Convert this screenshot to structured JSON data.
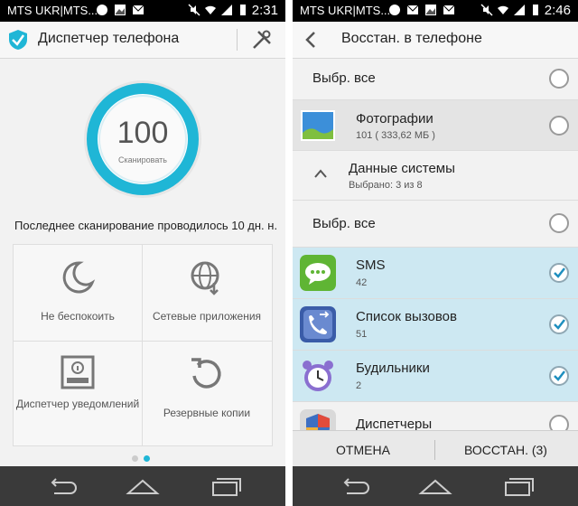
{
  "left_screen": {
    "status": {
      "carrier": "MTS UKR|MTS...",
      "time": "2:31"
    },
    "header": {
      "title": "Диспетчер телефона"
    },
    "gauge": {
      "score": "100",
      "label": "Сканировать"
    },
    "last_scan": "Последнее сканирование проводилось 10 дн. н...",
    "tiles": [
      {
        "label": "Не беспокоить",
        "icon": "moon-icon"
      },
      {
        "label": "Сетевые приложения",
        "icon": "globe-icon"
      },
      {
        "label": "Диспетчер уведомлений",
        "icon": "notification-icon"
      },
      {
        "label": "Резервные копии",
        "icon": "backup-icon"
      }
    ]
  },
  "right_screen": {
    "status": {
      "carrier": "MTS UKR|MTS...",
      "time": "2:46"
    },
    "header": {
      "title": "Восстан. в телефоне"
    },
    "select_all_1": "Выбр. все",
    "photos": {
      "title": "Фотографии",
      "subtitle": "101 ( 333,62 МБ )"
    },
    "system_data": {
      "title": "Данные системы",
      "subtitle": "Выбрано: 3 из 8"
    },
    "select_all_2": "Выбр. все",
    "items": [
      {
        "title": "SMS",
        "count": "42",
        "checked": true,
        "icon": "sms-icon"
      },
      {
        "title": "Список вызовов",
        "count": "51",
        "checked": true,
        "icon": "call-log-icon"
      },
      {
        "title": "Будильники",
        "count": "2",
        "checked": true,
        "icon": "alarm-clock-icon"
      },
      {
        "title": "Диспетчеры",
        "count": "",
        "checked": false,
        "icon": "shield-icon"
      }
    ],
    "buttons": {
      "cancel": "ОТМЕНА",
      "restore": "ВОССТАН. (3)"
    }
  },
  "colors": {
    "accent": "#1fb6d6",
    "selected_row": "#cde8f2",
    "nav_bar": "#3a3a3a"
  }
}
